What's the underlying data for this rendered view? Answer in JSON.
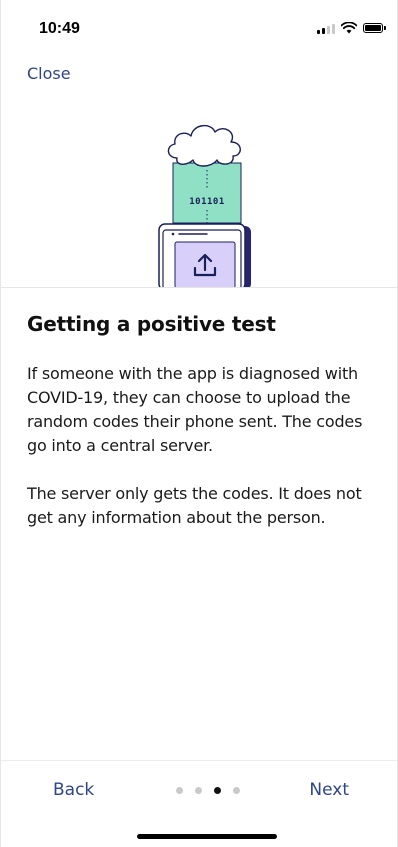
{
  "status_bar": {
    "time": "10:49",
    "signal_icon": "cellular-signal-icon",
    "wifi_icon": "wifi-icon",
    "battery_icon": "battery-icon"
  },
  "header": {
    "close_label": "Close"
  },
  "illustration": {
    "binary_text": "101101",
    "icons": [
      "cloud-icon",
      "phone-icon",
      "upload-icon"
    ],
    "colors": {
      "mint": "#8fe0c5",
      "lavender": "#d8d0fa",
      "navy": "#1b1f5a"
    }
  },
  "main": {
    "title": "Getting a positive test",
    "paragraphs": [
      "If someone with the app is diagnosed with COVID-19, they can choose to upload the random codes their phone sent. The codes go into a central server.",
      "The server only gets the codes. It does not get any information about the person."
    ]
  },
  "footer": {
    "back_label": "Back",
    "next_label": "Next",
    "page_indicator": {
      "total": 4,
      "current": 3
    }
  },
  "colors": {
    "link": "#2f4585",
    "dot_active": "#111111",
    "dot_inactive": "#c9c9c9"
  }
}
